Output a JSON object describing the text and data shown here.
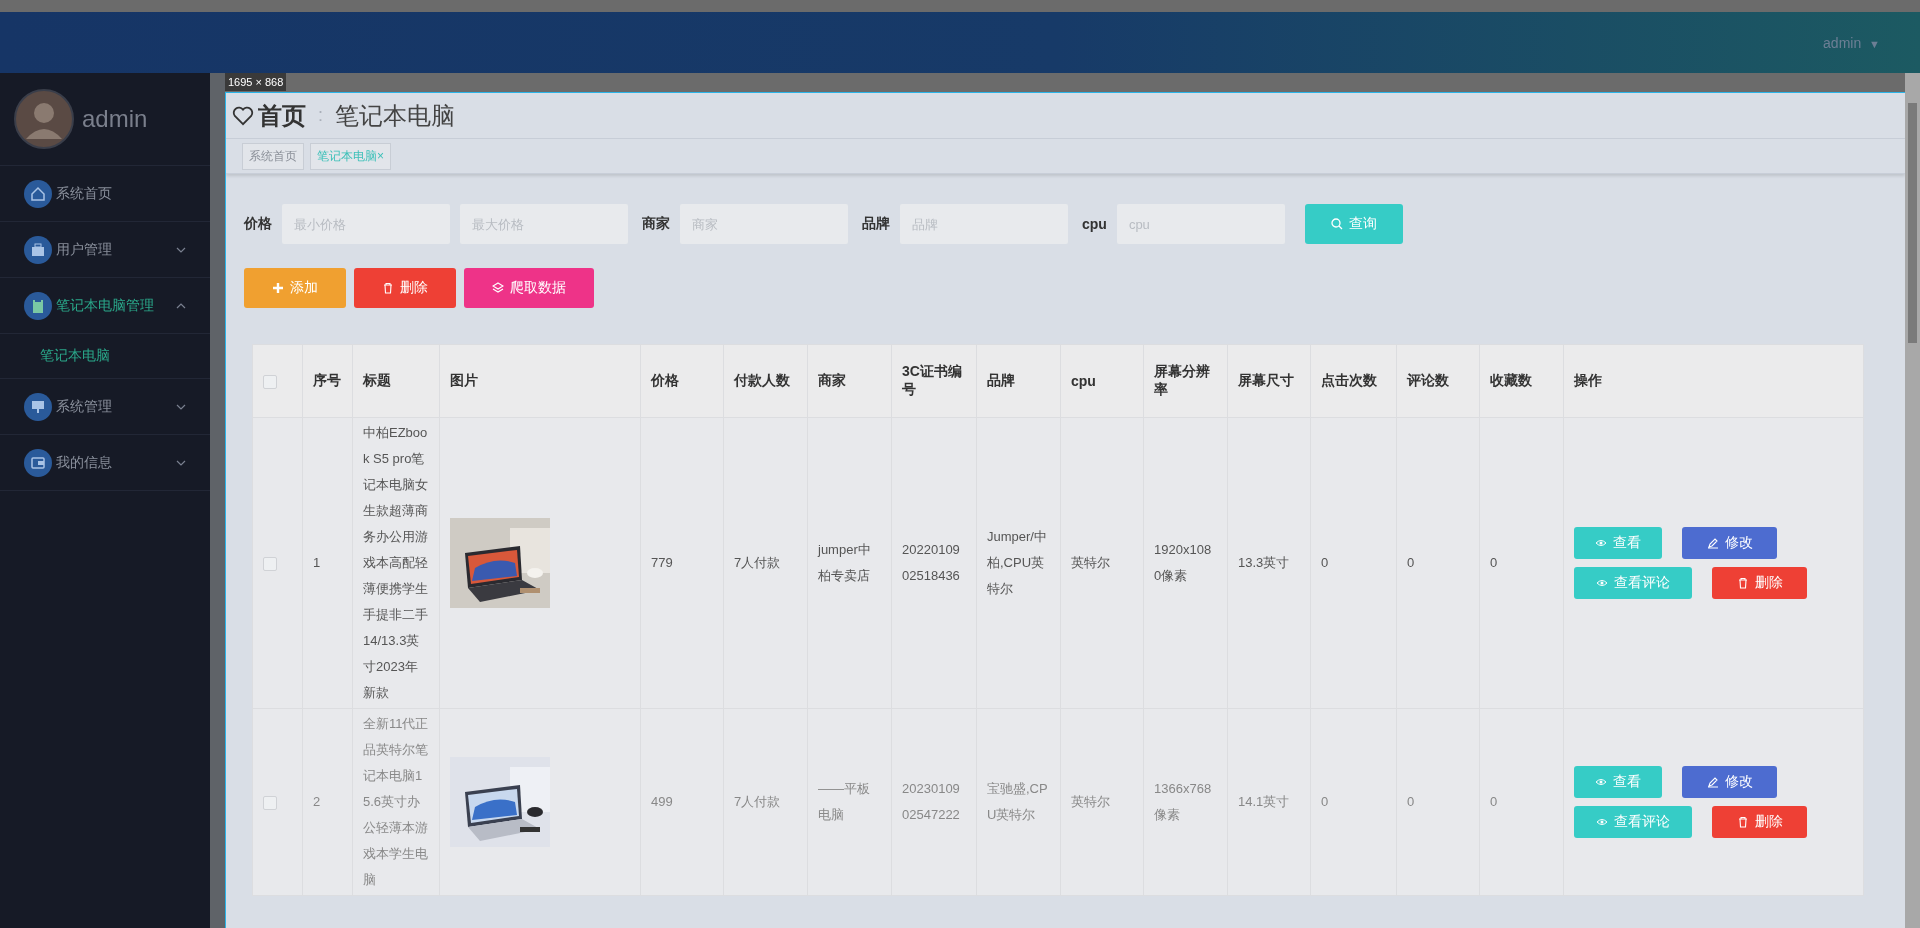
{
  "capture_label": "1695 × 868",
  "header": {
    "user": "admin",
    "caret": "▼"
  },
  "sidebar": {
    "user": "admin",
    "items": [
      {
        "label": "系统首页",
        "selected": false
      },
      {
        "label": "用户管理",
        "selected": false,
        "expanded": false
      },
      {
        "label": "笔记本电脑管理",
        "selected": true,
        "expanded": true,
        "children": [
          {
            "label": "笔记本电脑",
            "selected": true
          }
        ]
      },
      {
        "label": "系统管理",
        "selected": false,
        "expanded": false
      },
      {
        "label": "我的信息",
        "selected": false,
        "expanded": false
      }
    ]
  },
  "breadcrumb": {
    "home": "首页",
    "separator": ":",
    "current": "笔记本电脑"
  },
  "tabs": [
    {
      "label": "系统首页",
      "selected": false
    },
    {
      "label": "笔记本电脑",
      "selected": true,
      "close": "×"
    }
  ],
  "filters": [
    {
      "label": "价格",
      "placeholder": "最小价格"
    },
    {
      "placeholder": "最大价格"
    },
    {
      "label": "商家",
      "placeholder": "商家"
    },
    {
      "label": "品牌",
      "placeholder": "品牌"
    },
    {
      "label": "cpu",
      "placeholder": "cpu"
    }
  ],
  "search_button": "查询",
  "actions": [
    {
      "label": "添加",
      "kind": "add"
    },
    {
      "label": "删除",
      "kind": "delete"
    },
    {
      "label": "爬取数据",
      "kind": "crawl"
    }
  ],
  "table": {
    "columns": [
      "序号",
      "标题",
      "图片",
      "价格",
      "付款人数",
      "商家",
      "3C证书编号",
      "品牌",
      "cpu",
      "屏幕分辨率",
      "屏幕尺寸",
      "点击次数",
      "评论数",
      "收藏数",
      "操作"
    ],
    "header_checked": false,
    "rows": [
      {
        "checked": false,
        "cells": [
          "1",
          "中柏EZbook S5 pro笔记本电脑女生款超薄商务办公用游戏本高配轻薄便携学生手提非二手14/13.3英寸2023年新款",
          {
            "kind": "picture"
          },
          "779",
          "7人付款",
          "jumper中柏专卖店",
          "2022010902518436",
          "Jumper/中柏,CPU英特尔",
          "英特尔",
          "1920x1080像素",
          "13.3英寸",
          "0",
          "0",
          "0"
        ],
        "buttons": [
          {
            "label": "查看",
            "kind": "view"
          },
          {
            "label": "修改",
            "kind": "edit"
          },
          {
            "label": "查看评论",
            "kind": "view"
          },
          {
            "label": "删除",
            "kind": "delete"
          }
        ]
      },
      {
        "checked": false,
        "cells": [
          "2",
          "全新11代正品英特尔笔记本电脑15.6英寸办公轻薄本游戏本学生电脑",
          {
            "kind": "picture"
          },
          "499",
          "7人付款",
          "——平板电脑",
          "2023010902547222",
          "宝驰盛,CPU英特尔",
          "英特尔",
          "1366x768像素",
          "14.1英寸",
          "0",
          "0",
          "0"
        ],
        "buttons": [
          {
            "label": "查看",
            "kind": "view"
          },
          {
            "label": "修改",
            "kind": "edit"
          },
          {
            "label": "查看评论",
            "kind": "view"
          },
          {
            "label": "删除",
            "kind": "delete"
          }
        ]
      }
    ]
  }
}
